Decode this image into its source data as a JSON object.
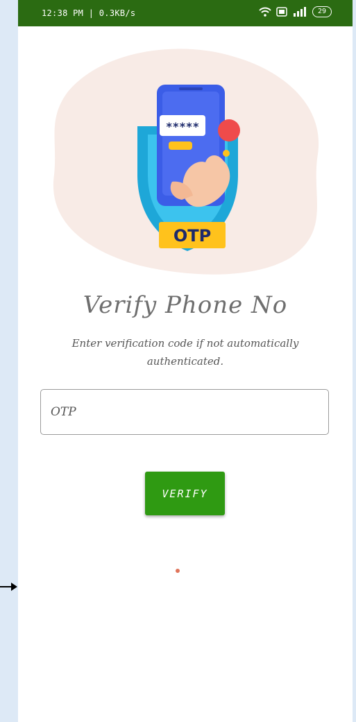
{
  "statusbar": {
    "time": "12:38 PM | 0.3KB/s",
    "battery": "29",
    "icons": [
      "wifi-icon",
      "volte-icon",
      "signal-icon",
      "battery-icon"
    ]
  },
  "hero": {
    "badge": "OTP",
    "masked_code": "*****"
  },
  "title": "Verify Phone No",
  "subtitle": "Enter verification code if not automatically authenticated.",
  "otp_input": {
    "placeholder": "OTP",
    "value": ""
  },
  "verify_button": "VERIFY",
  "colors": {
    "statusbar": "#2b6b12",
    "button": "#2f9a12",
    "title": "#6e6e6e",
    "page_background": "#dde9f6"
  }
}
